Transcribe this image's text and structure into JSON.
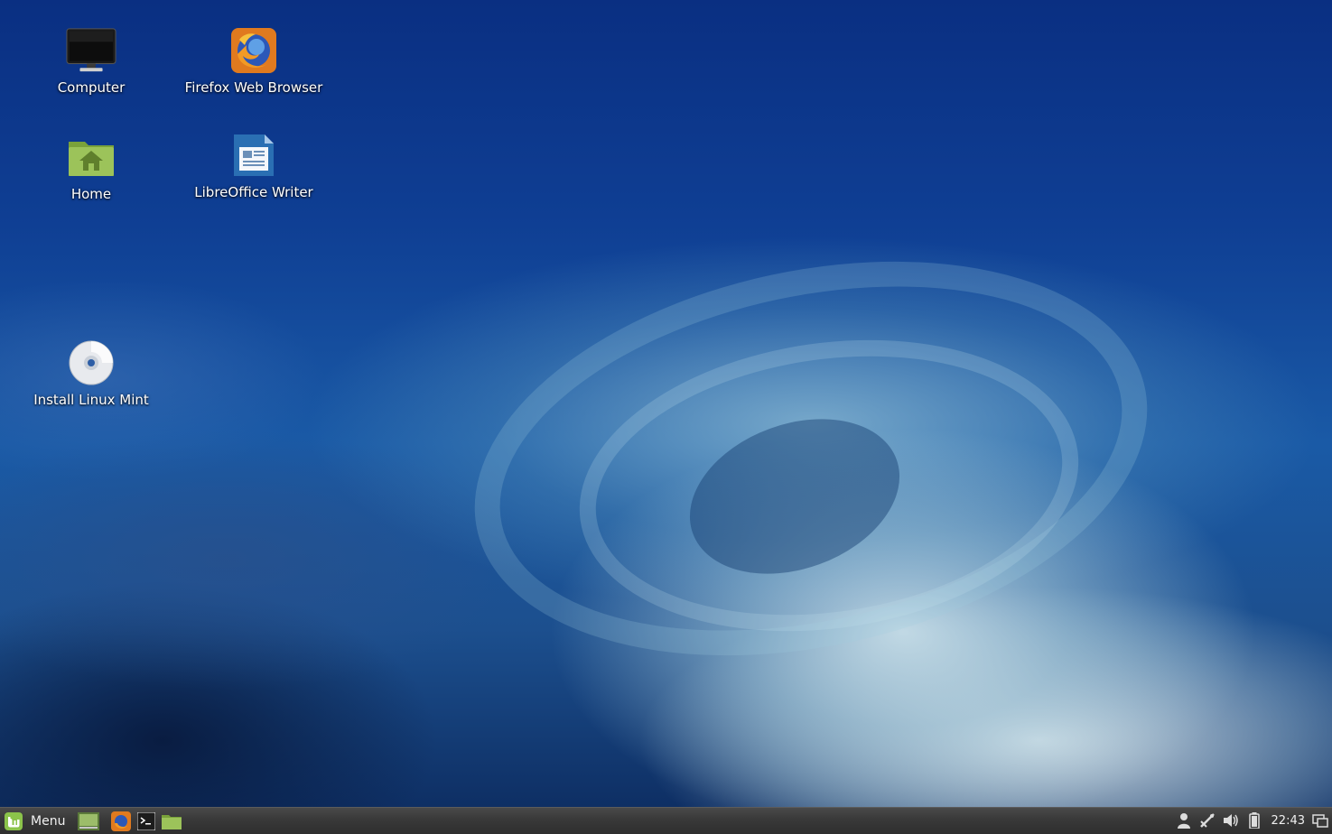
{
  "desktop": {
    "icons": [
      {
        "label": "Computer",
        "icon": "computer-icon"
      },
      {
        "label": "Firefox Web Browser",
        "icon": "firefox-icon"
      },
      {
        "label": "Home",
        "icon": "home-folder-icon"
      },
      {
        "label": "LibreOffice Writer",
        "icon": "libreoffice-writer-icon"
      },
      {
        "label": "Install Linux Mint",
        "icon": "disc-icon"
      }
    ]
  },
  "panel": {
    "menu_label": "Menu",
    "launchers": [
      "show-desktop-icon",
      "firefox-icon",
      "terminal-icon",
      "files-icon"
    ],
    "tray": [
      "user-icon",
      "network-icon",
      "volume-icon",
      "battery-icon"
    ],
    "clock": "22:43",
    "workspace_icon": "workspace-switcher-icon"
  },
  "colors": {
    "panel": "#3a3a3a",
    "mint_green": "#8bc34a"
  }
}
